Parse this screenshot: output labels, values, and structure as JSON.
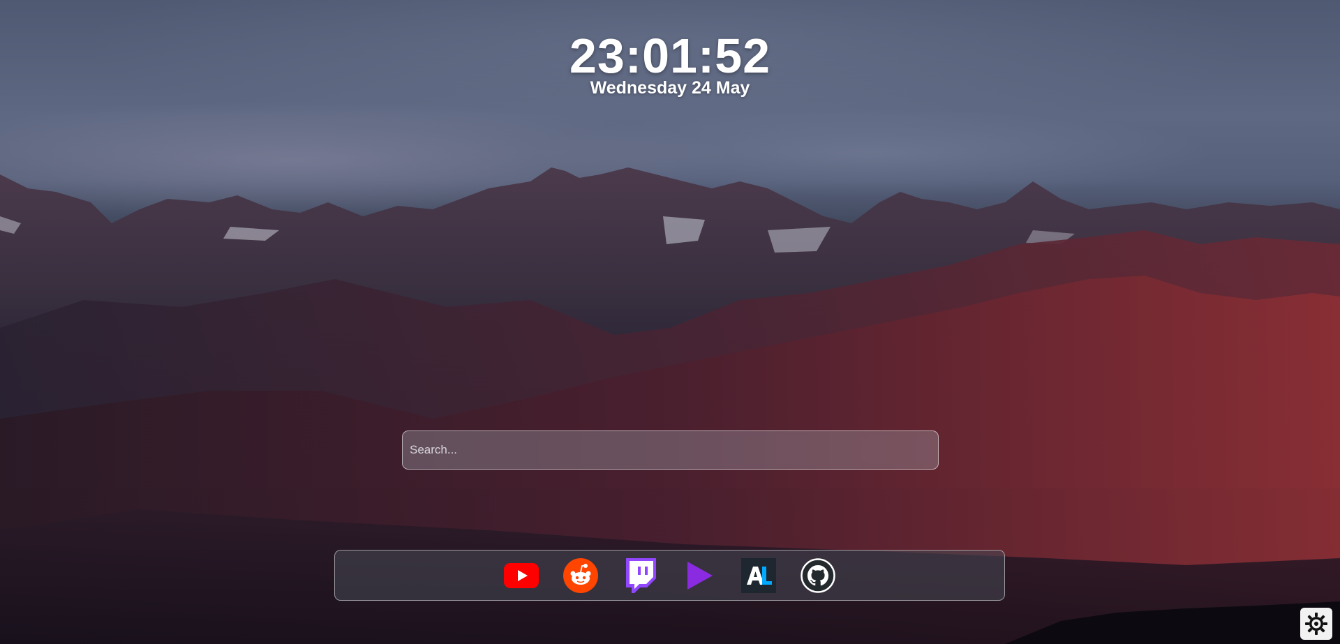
{
  "clock": {
    "time": "23:01:52",
    "date": "Wednesday 24 May"
  },
  "search": {
    "placeholder": "Search..."
  },
  "shortcuts": [
    {
      "name": "youtube",
      "icon": "youtube-icon",
      "color": "#ff0000"
    },
    {
      "name": "reddit",
      "icon": "reddit-icon",
      "color": "#ff4500"
    },
    {
      "name": "twitch",
      "icon": "twitch-icon",
      "color": "#9146ff"
    },
    {
      "name": "prime-video",
      "icon": "play-triangle-icon",
      "color": "#8a2be2"
    },
    {
      "name": "anilist",
      "icon": "anilist-icon",
      "color": "#02a9ff"
    },
    {
      "name": "github",
      "icon": "github-icon",
      "color": "#ffffff"
    }
  ],
  "settings": {
    "icon": "gear-icon"
  }
}
